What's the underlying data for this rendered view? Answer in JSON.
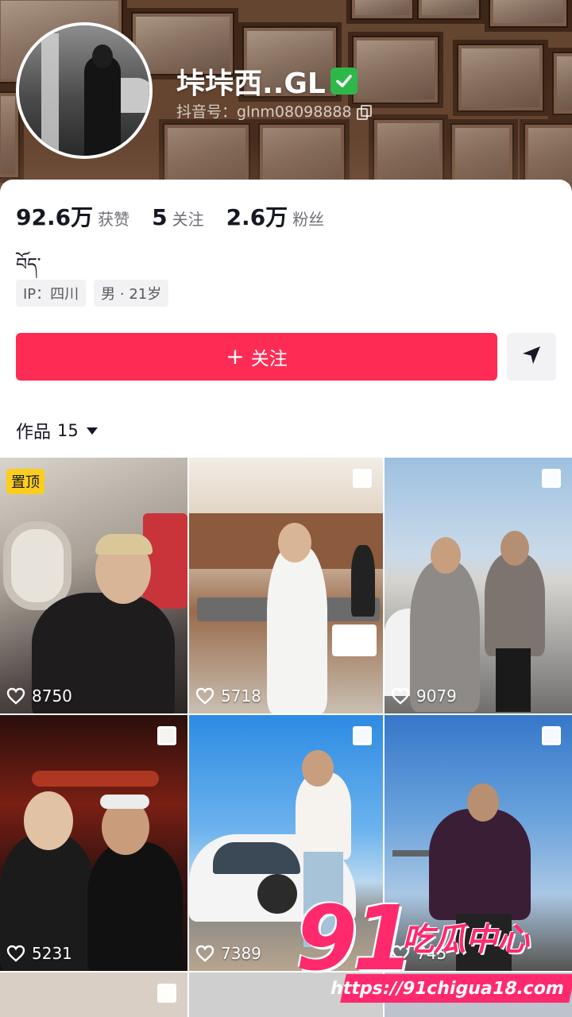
{
  "profile": {
    "nickname": "垰垰西..GL",
    "verified_icon": "check-mark-icon",
    "account_id": "抖音号：glnm08098888",
    "bio": "བོད་",
    "stats": [
      {
        "value": "92.6万",
        "label": "获赞"
      },
      {
        "value": "5",
        "label": "关注"
      },
      {
        "value": "2.6万",
        "label": "粉丝"
      }
    ],
    "tags": [
      {
        "label": "IP：四川"
      },
      {
        "label": "男 · 21岁"
      }
    ]
  },
  "actions": {
    "follow_plus": "+",
    "follow_label": "关注",
    "share_icon": "send-icon"
  },
  "works": {
    "tab_label": "作品",
    "count": "15",
    "pinned_label": "置顶",
    "items": [
      {
        "likes": "8750",
        "pinned": true,
        "multi": false
      },
      {
        "likes": "5718",
        "pinned": false,
        "multi": true
      },
      {
        "likes": "9079",
        "pinned": false,
        "multi": true
      },
      {
        "likes": "5231",
        "pinned": false,
        "multi": true
      },
      {
        "likes": "7389",
        "pinned": false,
        "multi": true
      },
      {
        "likes": "745",
        "pinned": false,
        "multi": true
      },
      {
        "likes": "",
        "pinned": false,
        "multi": true
      },
      {
        "likes": "",
        "pinned": false,
        "multi": true
      },
      {
        "likes": "",
        "pinned": false,
        "multi": true
      }
    ]
  },
  "watermark": {
    "number": "91",
    "text": "吃瓜中心",
    "url": "https://91chigua18.com"
  },
  "colors": {
    "accent": "#fe2c55",
    "pin_badge": "#facd1f",
    "watermark": "#ff2a6d"
  }
}
